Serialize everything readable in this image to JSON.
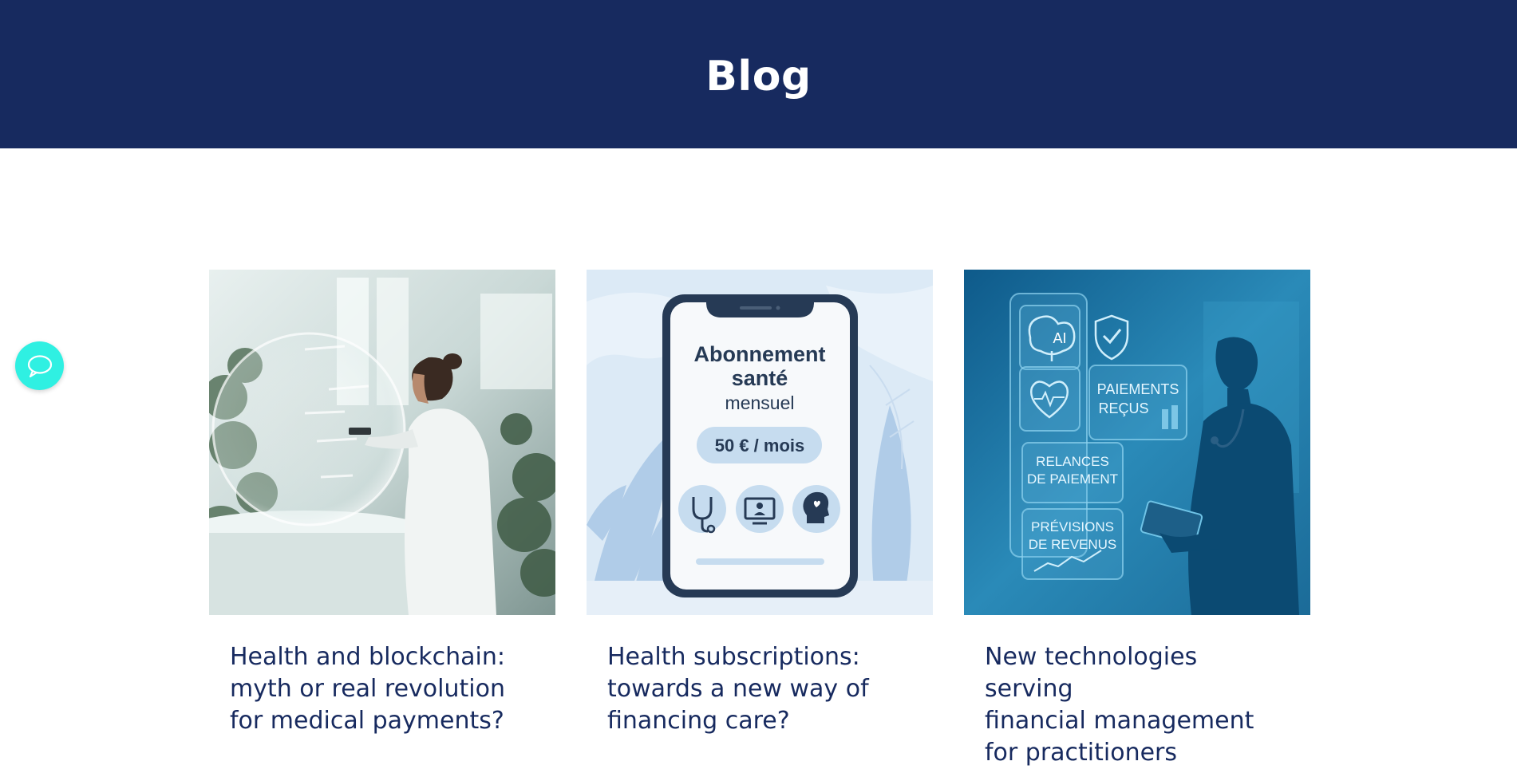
{
  "header": {
    "title": "Blog"
  },
  "chat": {
    "icon": "chat-bubble-icon",
    "color": "#2ff0e2"
  },
  "colors": {
    "header_bg": "#172a5f",
    "title_text": "#172a5f"
  },
  "cards": [
    {
      "title_line1": "Health and blockchain:",
      "title_line2": "myth or real revolution",
      "title_line3": "for medical payments?"
    },
    {
      "title_line1": "Health subscriptions:",
      "title_line2": "towards a new way of",
      "title_line3": "financing care?",
      "image_text": {
        "heading_line1": "Abonnement",
        "heading_line2": "santé",
        "subheading": "mensuel",
        "price": "50 € / mois"
      }
    },
    {
      "title_line1": "New technologies serving",
      "title_line2": "financial management",
      "title_line3": "for practitioners",
      "image_text": {
        "ai_label": "AI",
        "panel1_line1": "PAIEMENTS",
        "panel1_line2": "REÇUS",
        "panel2_line1": "RELANCES",
        "panel2_line2": "DE PAIEMENT",
        "panel3_line1": "PRÉVISIONS",
        "panel3_line2": "DE REVENUS"
      }
    }
  ]
}
